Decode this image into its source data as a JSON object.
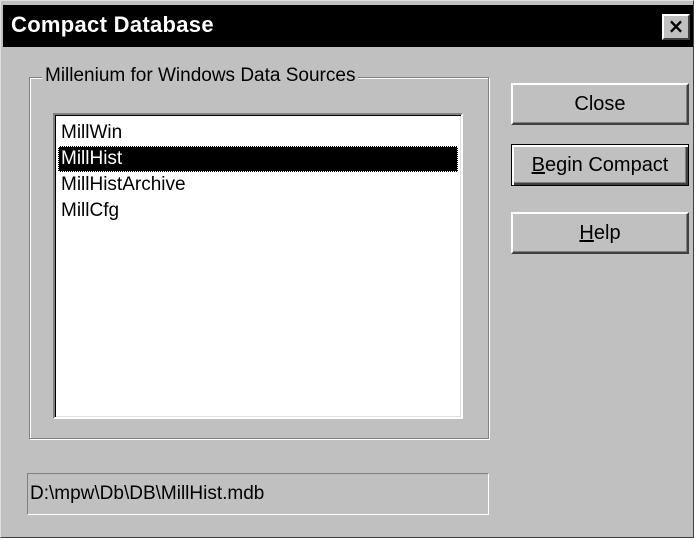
{
  "window": {
    "title": "Compact Database",
    "close_glyph": "×"
  },
  "group": {
    "label": "Millenium for Windows Data Sources"
  },
  "list": {
    "items": [
      {
        "label": "MillWin",
        "selected": false
      },
      {
        "label": "MillHist",
        "selected": true
      },
      {
        "label": "MillHistArchive",
        "selected": false
      },
      {
        "label": "MillCfg",
        "selected": false
      }
    ]
  },
  "buttons": {
    "close": {
      "label": "Close"
    },
    "begin_compact": {
      "mnemonic": "B",
      "rest": "egin Compact"
    },
    "help": {
      "mnemonic": "H",
      "rest": "elp"
    }
  },
  "path": {
    "value": "D:\\mpw\\Db\\DB\\MillHist.mdb"
  }
}
